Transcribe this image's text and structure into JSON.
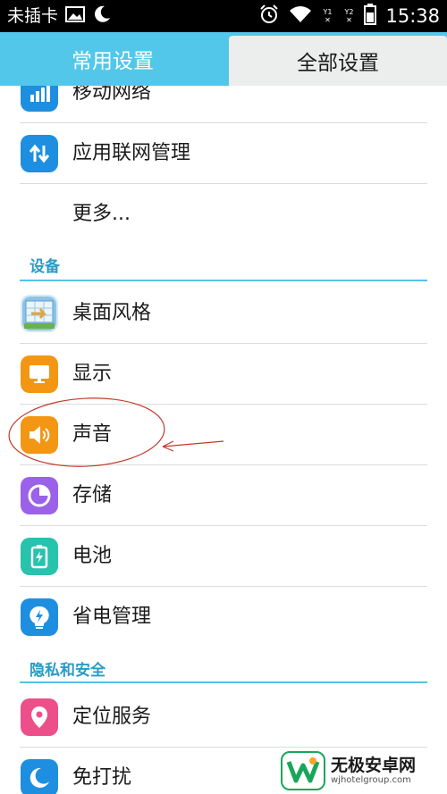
{
  "status_bar": {
    "carrier": "未插卡",
    "sim1_label": "Y1",
    "sim2_label": "Y2",
    "time": "15:38",
    "icons": [
      "image-icon",
      "moon-icon",
      "alarm-icon",
      "wifi-icon",
      "battery-icon"
    ]
  },
  "tabs": {
    "common": "常用设置",
    "all": "全部设置",
    "selected": "all",
    "bar_color": "#53c7ea"
  },
  "list": {
    "network_items": [
      {
        "label": "移动网络",
        "icon": "mobile-network-icon",
        "color": "#1e8fe0"
      },
      {
        "label": "应用联网管理",
        "icon": "app-network-icon",
        "color": "#1e8fe0"
      },
      {
        "label": "更多...",
        "icon": "",
        "color": ""
      }
    ],
    "device_section": {
      "title": "设备",
      "items": [
        {
          "label": "桌面风格",
          "icon": "desktop-style-icon",
          "color": "#7dbbe2"
        },
        {
          "label": "显示",
          "icon": "display-icon",
          "color": "#f39613"
        },
        {
          "label": "声音",
          "icon": "sound-icon",
          "color": "#f39613"
        },
        {
          "label": "存储",
          "icon": "storage-icon",
          "color": "#9b61e8"
        },
        {
          "label": "电池",
          "icon": "battery-settings-icon",
          "color": "#27c3ac"
        },
        {
          "label": "省电管理",
          "icon": "power-saving-icon",
          "color": "#1e8fe0"
        }
      ]
    },
    "privacy_section": {
      "title": "隐私和安全",
      "items": [
        {
          "label": "定位服务",
          "icon": "location-icon",
          "color": "#ec4f8a"
        },
        {
          "label": "免打扰",
          "icon": "do-not-disturb-icon",
          "color": "#1e8fe0"
        }
      ]
    }
  },
  "watermark": {
    "name": "无极安卓网",
    "url": "wjhotelgroup.com"
  },
  "annotation_color": "#c0392b",
  "section_title_color": "#2a9cc4"
}
